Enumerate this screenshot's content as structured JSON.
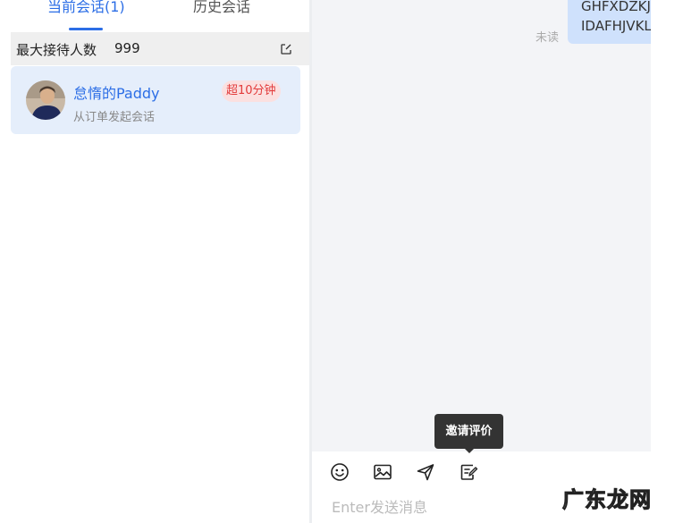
{
  "tabs": {
    "current": "当前会话(1)",
    "history": "历史会话"
  },
  "reception": {
    "label": "最大接待人数",
    "value": "999"
  },
  "session": {
    "name": "怠惰的Paddy",
    "subtitle": "从订单发起会话",
    "badge": "超10分钟"
  },
  "chat": {
    "status": "未读",
    "bubble_lines": [
      "GHFXDZKJ",
      "IDAFHJVKL"
    ]
  },
  "toolbar": {
    "icons": [
      "emoji-icon",
      "image-icon",
      "send-icon",
      "evaluate-icon"
    ],
    "tooltip": "邀请评价"
  },
  "input": {
    "placeholder": "Enter发送消息"
  },
  "watermark": "广东龙网",
  "colors": {
    "accent": "#2c6ee6",
    "badge_bg": "#fbe0e0",
    "badge_text": "#e23b3b",
    "bubble": "#cfe1fc",
    "session_bg": "#e5eefb"
  }
}
